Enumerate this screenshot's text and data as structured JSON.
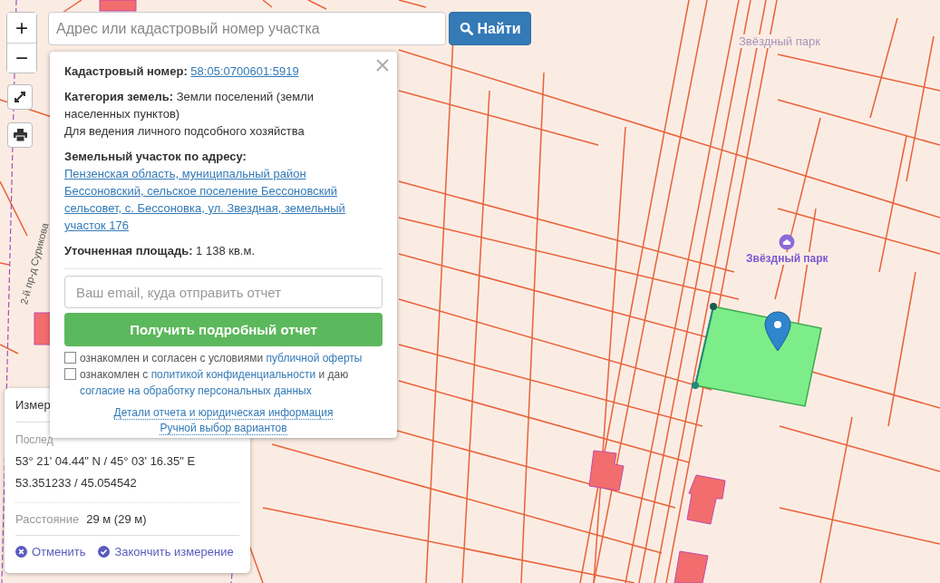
{
  "search": {
    "placeholder": "Адрес или кадастровый номер участка",
    "button": "Найти"
  },
  "map_controls": {
    "zoom_in": "+",
    "zoom_out": "−"
  },
  "map_labels": [
    {
      "text": "Звёздный парк",
      "kind": "area"
    },
    {
      "text": "Звёздный парк",
      "kind": "poi"
    },
    {
      "text": "2-й пр-д Сурикова",
      "kind": "street"
    }
  ],
  "popup": {
    "fields": [
      {
        "kind": "link",
        "label": "Кадастровый номер:",
        "value": "58:05:0700601:5919"
      },
      {
        "kind": "text",
        "label": "Категория земель:",
        "value": "Земли поселений (земли населенных пунктов)",
        "note": "Для ведения личного подсобного хозяйства"
      },
      {
        "kind": "link",
        "label": "Земельный участок по адресу:",
        "value": "Пензенская область, муниципальный район Бессоновский, сельское поселение Бессоновский сельсовет, с. Бессоновка, ул. Звездная, земельный участок 176"
      },
      {
        "kind": "text",
        "label": "Уточненная площадь:",
        "value": "1 138 кв.м."
      }
    ],
    "email": {
      "placeholder": "Ваш email, куда отправить отчет"
    },
    "submit": "Получить подробный отчет",
    "agreements": [
      {
        "checked": false,
        "parts": [
          {
            "text": "ознакомлен и согласен с условиями ",
            "kind": "text"
          },
          {
            "text": "публичной оферты",
            "kind": "link"
          }
        ]
      },
      {
        "checked": false,
        "parts": [
          {
            "text": "ознакомлен с ",
            "kind": "text"
          },
          {
            "text": "политикой конфиденциальности",
            "kind": "link"
          },
          {
            "text": " и даю ",
            "kind": "text"
          },
          {
            "text": "согласие на обработку персональных данных",
            "kind": "link"
          }
        ]
      }
    ],
    "footer_links": [
      "Детали отчета и юридическая информация",
      "Ручной выбор вариантов"
    ]
  },
  "measure": {
    "title": "Измер",
    "last_point_label": "Послед",
    "dms": "53° 21' 04.44\" N / 45° 03' 16.35\" E",
    "decimal": "53.351233 / 45.054542",
    "distance_label": "Расстояние",
    "distance": "29 м (29 м)",
    "actions": [
      {
        "kind": "cancel",
        "label": "Отменить"
      },
      {
        "kind": "finish",
        "label": "Закончить измерение"
      }
    ]
  }
}
